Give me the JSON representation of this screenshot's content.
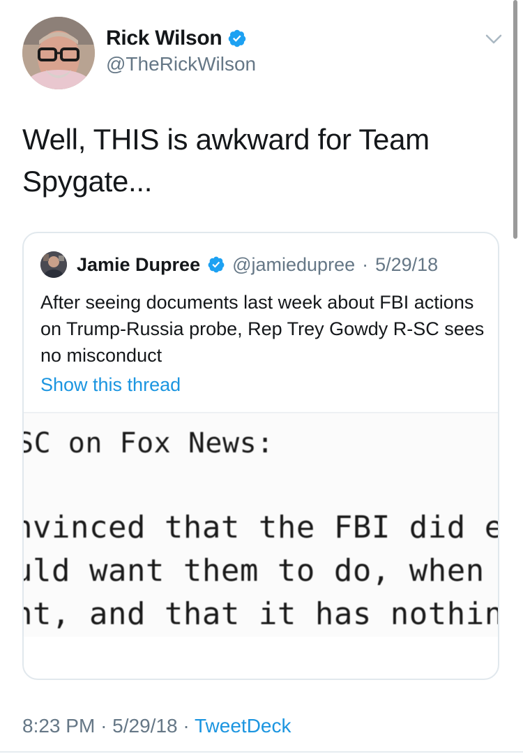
{
  "tweet": {
    "author": {
      "name": "Rick Wilson",
      "handle": "@TheRickWilson",
      "verified": true
    },
    "text": "Well, THIS is awkward for Team Spygate...",
    "quoted": {
      "author": {
        "name": "Jamie Dupree",
        "handle": "@jamiedupree",
        "verified": true
      },
      "separator": "·",
      "date": "5/29/18",
      "text": "After seeing documents last week about FBI actions on Trump-Russia probe, Rep Trey Gowdy R-SC sees no misconduct",
      "thread_link": "Show this thread",
      "image_lines": [
        "SC on Fox News:",
        "nvinced that the FBI did e",
        "uld want them to do, when ",
        "nt, and that it has nothing"
      ]
    },
    "footer": {
      "time": "8:23 PM",
      "separator": "·",
      "date": "5/29/18",
      "source": "TweetDeck"
    }
  },
  "colors": {
    "link": "#1b95e0",
    "secondary_text": "#657786",
    "verified_badge": "#1da1f2",
    "border": "#e1e8ed"
  },
  "icons": {
    "verified": "verified-badge-icon",
    "menu": "chevron-down-icon"
  }
}
